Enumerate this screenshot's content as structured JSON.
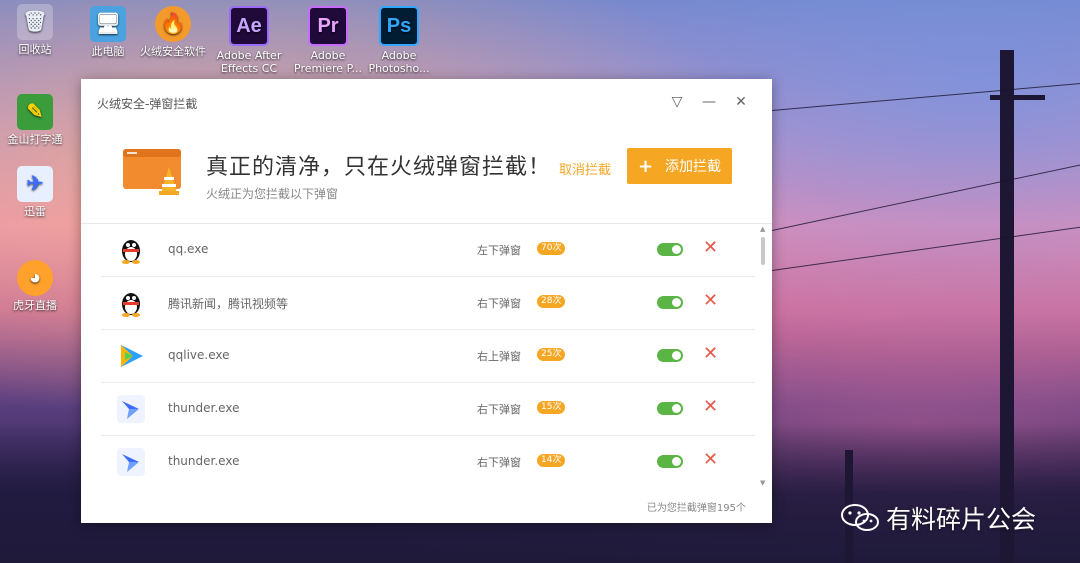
{
  "desktop": {
    "icons": [
      {
        "label": "回收站",
        "glyph": "🗑"
      },
      {
        "label": "此电脑",
        "glyph": "🖥"
      },
      {
        "label": "火绒安全软件",
        "glyph": "🔥"
      },
      {
        "label": "Adobe After Effects CC ...",
        "glyph": "Ae"
      },
      {
        "label": "Adobe Premiere P...",
        "glyph": "Pr"
      },
      {
        "label": "Adobe Photosho...",
        "glyph": "Ps"
      },
      {
        "label": "金山打字通",
        "glyph": "✎"
      },
      {
        "label": "迅雷",
        "glyph": "✈"
      },
      {
        "label": "虎牙直播",
        "glyph": "◕"
      }
    ]
  },
  "window": {
    "title": "火绒安全-弹窗拦截",
    "controls": {
      "menu": "▽",
      "minimize": "—",
      "close": "✕"
    },
    "header": {
      "title": "真正的清净，只在火绒弹窗拦截！",
      "subtitle": "火绒正为您拦截以下弹窗",
      "cancel_label": "取消拦截",
      "add_label": "添加拦截",
      "add_icon": "+"
    },
    "rows": [
      {
        "name": "qq.exe",
        "position": "左下弹窗",
        "count": "70次",
        "icon": "qq-penguin-icon",
        "enabled": true
      },
      {
        "name": "腾讯新闻，腾讯视频等",
        "position": "右下弹窗",
        "count": "28次",
        "icon": "qq-penguin-icon",
        "enabled": true
      },
      {
        "name": "qqlive.exe",
        "position": "右上弹窗",
        "count": "25次",
        "icon": "tencent-video-icon",
        "enabled": true
      },
      {
        "name": "thunder.exe",
        "position": "右下弹窗",
        "count": "15次",
        "icon": "thunder-bird-icon",
        "enabled": true
      },
      {
        "name": "thunder.exe",
        "position": "右下弹窗",
        "count": "14次",
        "icon": "thunder-bird-icon",
        "enabled": true
      }
    ],
    "delete_glyph": "✕",
    "footer": "已为您拦截弹窗195个"
  },
  "watermark": {
    "text": "有料碎片公会",
    "icon": "wechat-icon"
  },
  "colors": {
    "accent": "#f5a623",
    "toggle_on": "#5bb544",
    "delete": "#e8594a"
  }
}
